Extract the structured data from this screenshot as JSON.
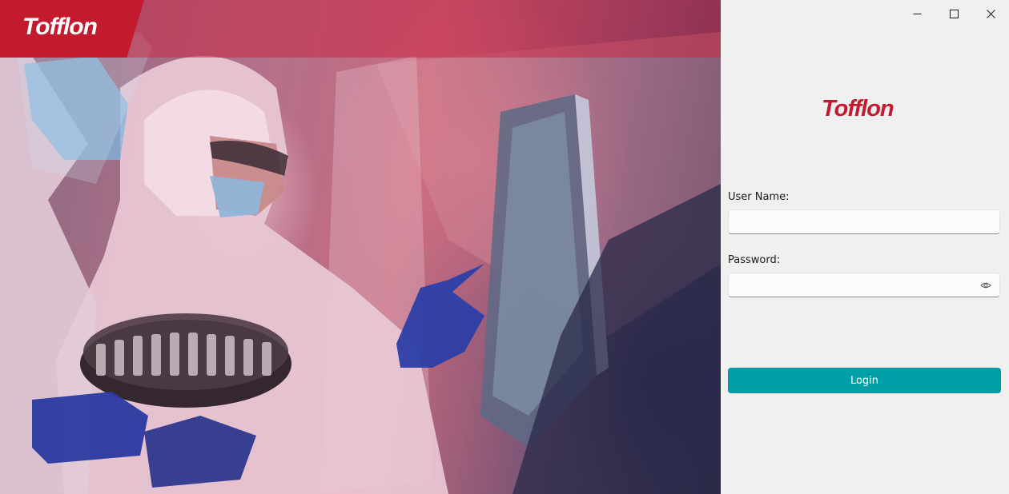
{
  "hero": {
    "brand_text": "Tofflon",
    "image": "cleanroom-technicians-photo"
  },
  "window_controls": {
    "minimize": "minimize-icon",
    "maximize": "maximize-icon",
    "close": "close-icon"
  },
  "login": {
    "logo_text": "Tofflon",
    "username_label": "User Name:",
    "username_value": "",
    "password_label": "Password:",
    "password_value": "",
    "password_toggle_icon": "eye-icon",
    "submit_label": "Login"
  },
  "colors": {
    "brand_red": "#c41a2e",
    "login_button": "#00a0a8",
    "panel_bg": "#f0f0f0"
  }
}
